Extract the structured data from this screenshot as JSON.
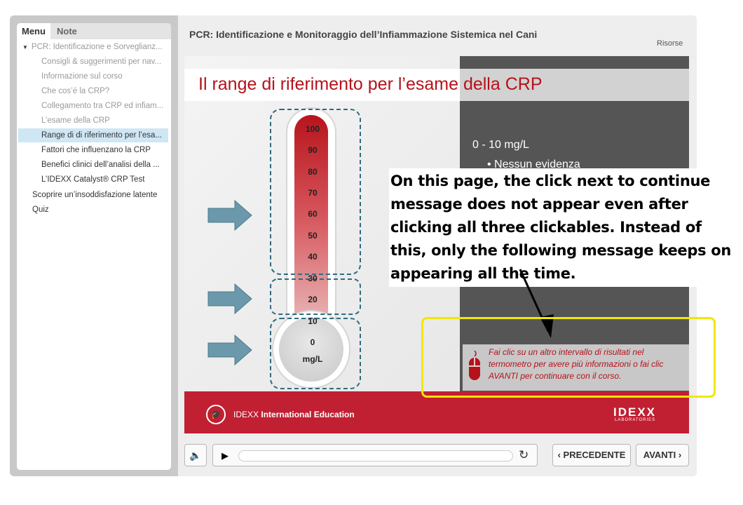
{
  "sidebar": {
    "tabs": [
      "Menu",
      "Note"
    ],
    "items": [
      {
        "label": "PCR: Identificazione e Sorveglianz...",
        "state": "visited",
        "level": 0,
        "expanded": true
      },
      {
        "label": "Consigli & suggerimenti per nav...",
        "state": "visited",
        "level": 1
      },
      {
        "label": "Informazione sul corso",
        "state": "visited",
        "level": 1
      },
      {
        "label": "Che cos’é la CRP?",
        "state": "visited",
        "level": 1
      },
      {
        "label": "Collegamento tra CRP ed infiam...",
        "state": "visited",
        "level": 1
      },
      {
        "label": "L’esame della CRP",
        "state": "visited",
        "level": 1
      },
      {
        "label": "Range di di riferimento per l’esa...",
        "state": "selected",
        "level": 1
      },
      {
        "label": "Fattori che influenzano la CRP",
        "state": "normal",
        "level": 1
      },
      {
        "label": "Benefici clinici dell’analisi della ...",
        "state": "normal",
        "level": 1
      },
      {
        "label": "L’IDEXX Catalyst® CRP Test",
        "state": "normal",
        "level": 1
      },
      {
        "label": "Scoprire un’insoddisfazione latente",
        "state": "normal",
        "level": 0
      },
      {
        "label": "Quiz",
        "state": "normal",
        "level": 0
      }
    ]
  },
  "header": {
    "course_title": "PCR: Identificazione e Monitoraggio  dell’Infiammazione Sistemica nel Cani",
    "resources_link": "Risorse"
  },
  "slide": {
    "title": "Il range di riferimento per l’esame della CRP",
    "thermometer": {
      "ticks": [
        "100",
        "90",
        "80",
        "70",
        "60",
        "50",
        "40",
        "30",
        "20",
        "10",
        "0"
      ],
      "unit": "mg/L"
    },
    "info_panel": {
      "range": "0 - 10 mg/L",
      "bullet": "• Nessun evidenza"
    },
    "message": "Fai clic su un altro intervallo di risultati nel termometro per avere più informazioni o fai clic AVANTI per continuare con il corso.",
    "footer": {
      "brand_prefix": "IDEXX",
      "brand_suffix": "International Education",
      "logo": "IDEXX",
      "logo_sub": "LABORATORIES"
    }
  },
  "annotation": {
    "text": "On this page, the click next to continue message does not appear even after clicking all three clickables. Instead of this, only the following message keeps on appearing all the time.",
    "highlight_color": "#f2e600"
  },
  "controls": {
    "prev_label": "PRECEDENTE",
    "next_label": "AVANTI"
  },
  "colors": {
    "accent_red": "#b5121b",
    "footer_red": "#c11f32",
    "arrow_blue": "#6b99ab",
    "selected_bg": "#cfe6f4"
  },
  "icons": [
    "volume-icon",
    "play-icon",
    "reload-icon",
    "chevron-left-icon",
    "chevron-right-icon",
    "mouse-icon",
    "graduation-cap-icon",
    "arrow-right-icon"
  ]
}
